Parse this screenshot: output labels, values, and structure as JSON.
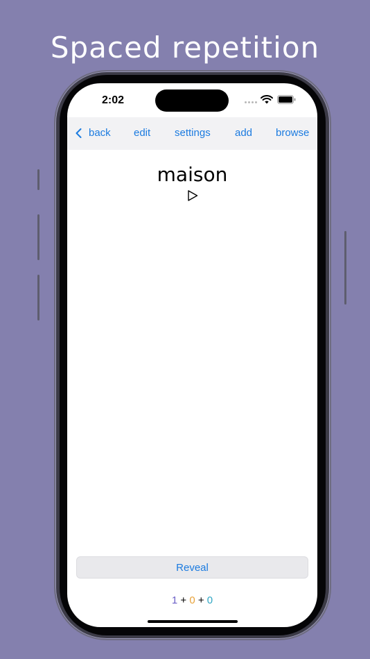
{
  "headline": "Spaced repetition",
  "status_bar": {
    "time": "2:02"
  },
  "nav": {
    "back_label": "back",
    "edit_label": "edit",
    "settings_label": "settings",
    "add_label": "add",
    "browse_label": "browse"
  },
  "card": {
    "front_text": "maison"
  },
  "reveal_label": "Reveal",
  "counts": {
    "new": "1",
    "learning": "0",
    "review": "0",
    "separator": "+"
  },
  "colors": {
    "background": "#8480ae",
    "accent": "#1b7be0",
    "new_count": "#6b5fc7",
    "learning_count": "#e8a23a",
    "review_count": "#2fa6c4"
  },
  "icons": {
    "back": "chevron-left-icon",
    "play": "play-icon",
    "wifi": "wifi-icon",
    "battery": "battery-icon",
    "signal": "signal-dots-icon"
  }
}
